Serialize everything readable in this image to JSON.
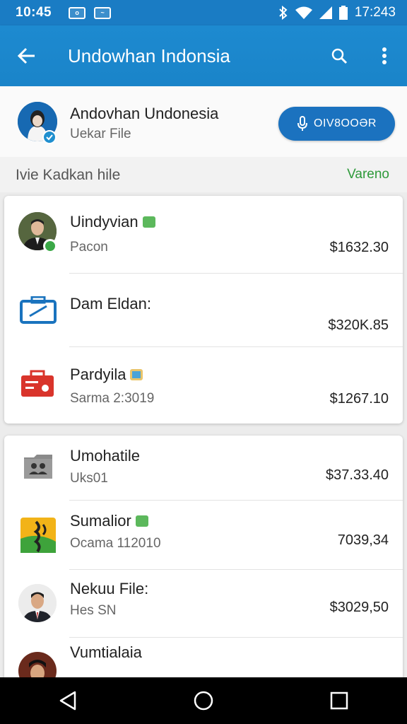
{
  "status_bar": {
    "time_left": "10:45",
    "time_right": "17:243",
    "notification_icons": [
      "notification-icon-1",
      "notification-icon-2"
    ]
  },
  "app_bar": {
    "title": "Undowhan Indonsia",
    "back_icon": "arrow-back-icon",
    "search_icon": "search-icon",
    "more_icon": "more-vert-icon"
  },
  "profile": {
    "name": "Andovhan Undonesia",
    "subtitle": "Uekar File",
    "button_label": "OIV8OOƏR",
    "button_icon": "microphone-icon"
  },
  "section": {
    "label": "Ivie Kadkan hile",
    "link": "Vareno"
  },
  "card1": [
    {
      "name": "Uindyvian",
      "sub": "Pacon",
      "amount": "$1632.30",
      "icon": "person-avatar",
      "chip_color": "#5cb85c"
    },
    {
      "name": "Dam Eldan:",
      "sub": "",
      "amount": "$320K.85",
      "icon": "briefcase-icon",
      "chip_color": ""
    },
    {
      "name": "Pardyila",
      "sub": "Sarma 2:3019",
      "amount": "$1267.10",
      "icon": "toolbox-icon",
      "chip_color": "#4aa3d8"
    }
  ],
  "card2": [
    {
      "name": "Umohatile",
      "sub": "Uks01",
      "amount": "$37.33.40",
      "icon": "contacts-folder-icon",
      "chip_color": ""
    },
    {
      "name": "Sumalior",
      "sub": "Ocama 112010",
      "amount": "7039,34",
      "icon": "tree-app-icon",
      "chip_color": "#5cb85c"
    },
    {
      "name": "Nekuu File:",
      "sub": "Hes SN",
      "amount": "$3029,50",
      "icon": "person-avatar",
      "chip_color": ""
    },
    {
      "name": "Vumtialaia",
      "sub": "",
      "amount": "",
      "icon": "person-avatar",
      "chip_color": ""
    }
  ],
  "colors": {
    "app_bar": "#1a84c9",
    "accent_green": "#2e9a3a",
    "button_blue": "#1b72bf"
  }
}
